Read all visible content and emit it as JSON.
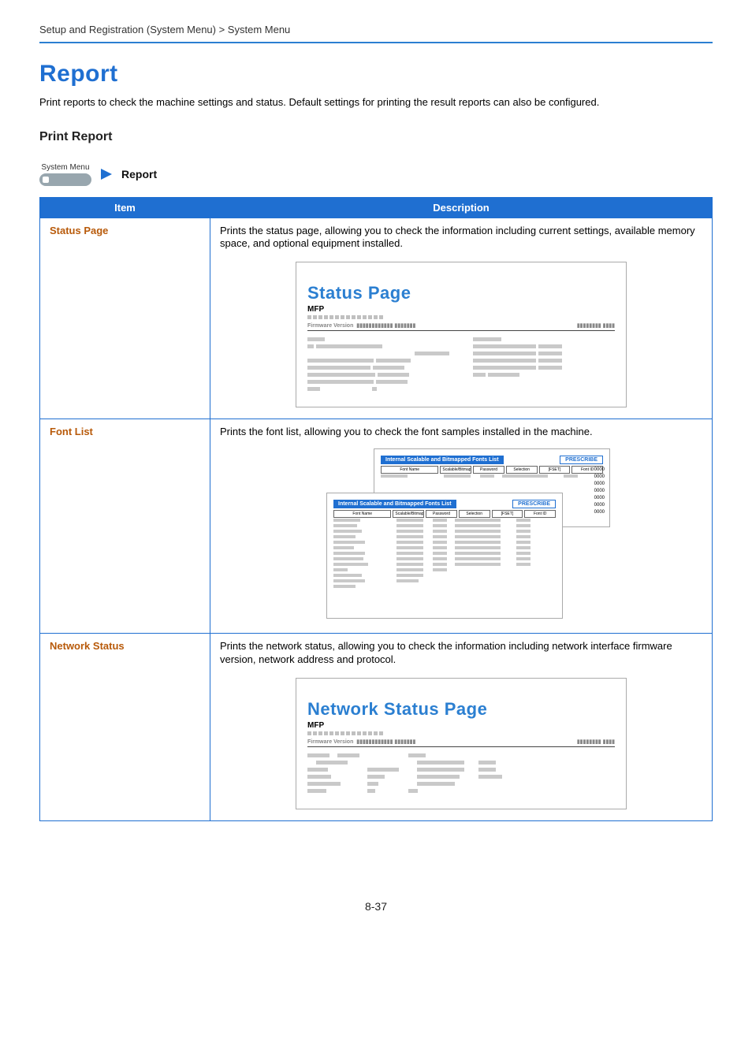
{
  "breadcrumb": "Setup and Registration (System Menu) > System Menu",
  "heading": "Report",
  "intro": "Print reports to check the machine settings and status. Default settings for printing the result reports can also be configured.",
  "subhead": "Print Report",
  "nav": {
    "button_label": "System Menu",
    "step_label": "Report"
  },
  "table": {
    "headers": {
      "item": "Item",
      "desc": "Description"
    },
    "rows": [
      {
        "item": "Status Page",
        "desc": "Prints the status page, allowing you to check the information including current settings, available memory space, and optional equipment installed.",
        "sample": {
          "title": "Status Page",
          "sub": "MFP",
          "fw_label": "Firmware Version"
        }
      },
      {
        "item": "Font List",
        "desc": "Prints the font list, allowing you to check the font samples installed in the machine.",
        "fontlist": {
          "banner": "Internal Scalable and Bitmapped Fonts List",
          "prescribe": "PRESCRIBE",
          "cols": [
            "Font Name",
            "Scalable/Bitmap",
            "Password",
            "Selection",
            "[FSET]",
            "Font ID"
          ]
        }
      },
      {
        "item": "Network Status",
        "desc": "Prints the network status, allowing you to check the information including network interface firmware version, network address and protocol.",
        "sample": {
          "title": "Network Status Page",
          "sub": "MFP",
          "fw_label": "Firmware Version"
        }
      }
    ]
  },
  "page_number": "8-37"
}
